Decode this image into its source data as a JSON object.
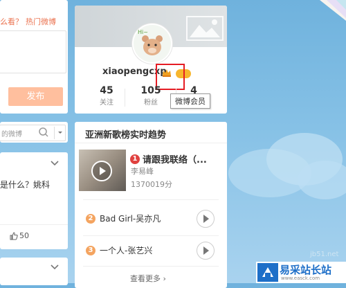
{
  "composer": {
    "prompt": "么看？",
    "hot_link": "热门微博",
    "publish_label": "发布"
  },
  "search": {
    "placeholder": "的微博"
  },
  "feed": {
    "text": "是什么？姚科",
    "like_count": "50"
  },
  "profile": {
    "username": "xiaopengcxp",
    "stats": [
      {
        "value": "45",
        "label": "关注"
      },
      {
        "value": "105",
        "label": "粉丝"
      },
      {
        "value": "4",
        "label": ""
      }
    ],
    "vip_tooltip": "微博会员"
  },
  "trend": {
    "title": "亚洲新歌榜实时趋势",
    "top": {
      "rank": "1",
      "song": "请跟我联络（...",
      "artist": "李易峰",
      "plays": "1370019分"
    },
    "items": [
      {
        "rank": "2",
        "song": "Bad Girl-吴亦凡"
      },
      {
        "rank": "3",
        "song": "一个人-张艺兴"
      }
    ],
    "more_label": "查看更多 ›"
  },
  "watermark": {
    "small": "jb51.net",
    "brand": "易采站长站",
    "url": "www.easck.com"
  },
  "colors": {
    "accent": "#eb7350",
    "rank1": "#e0413f",
    "rank_other": "#f4a460",
    "highlight_box": "#e51c23"
  }
}
